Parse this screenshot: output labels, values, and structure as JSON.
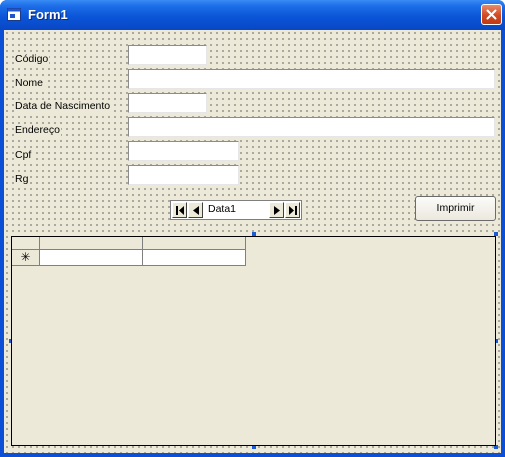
{
  "window": {
    "title": "Form1"
  },
  "form": {
    "fields": [
      {
        "label": "Código",
        "value": ""
      },
      {
        "label": "Nome",
        "value": ""
      },
      {
        "label": "Data de Nascimento",
        "value": ""
      },
      {
        "label": "Endereço",
        "value": ""
      },
      {
        "label": "Cpf",
        "value": ""
      },
      {
        "label": "Rg",
        "value": ""
      }
    ]
  },
  "data_control": {
    "caption": "Data1"
  },
  "buttons": {
    "print_label": "Imprimir"
  },
  "grid": {
    "new_row_marker": "✳"
  },
  "colors": {
    "titlebar": "#0a55d8",
    "form_bg": "#ece9d8",
    "close": "#d24a22"
  }
}
